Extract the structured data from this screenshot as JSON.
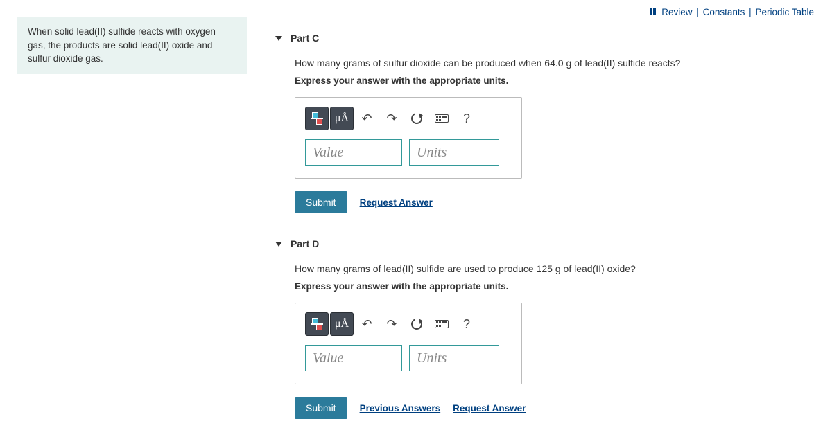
{
  "problem_statement": "When solid lead(II) sulfide reacts with oxygen gas, the products are solid lead(II) oxide and sulfur dioxide gas.",
  "top_links": {
    "review": "Review",
    "constants": "Constants",
    "periodic_table": "Periodic Table"
  },
  "partC": {
    "title": "Part C",
    "question": "How many grams of sulfur dioxide can be produced when 64.0 g of lead(II) sulfide reacts?",
    "instruction": "Express your answer with the appropriate units.",
    "value_placeholder": "Value",
    "units_placeholder": "Units",
    "submit_label": "Submit",
    "request_answer": "Request Answer"
  },
  "partD": {
    "title": "Part D",
    "question": "How many grams of lead(II) sulfide are used to produce 125 g of lead(II) oxide?",
    "instruction": "Express your answer with the appropriate units.",
    "value_placeholder": "Value",
    "units_placeholder": "Units",
    "submit_label": "Submit",
    "previous_answers": "Previous Answers",
    "request_answer": "Request Answer"
  },
  "toolbar": {
    "mu_a": "μÅ",
    "help": "?"
  }
}
